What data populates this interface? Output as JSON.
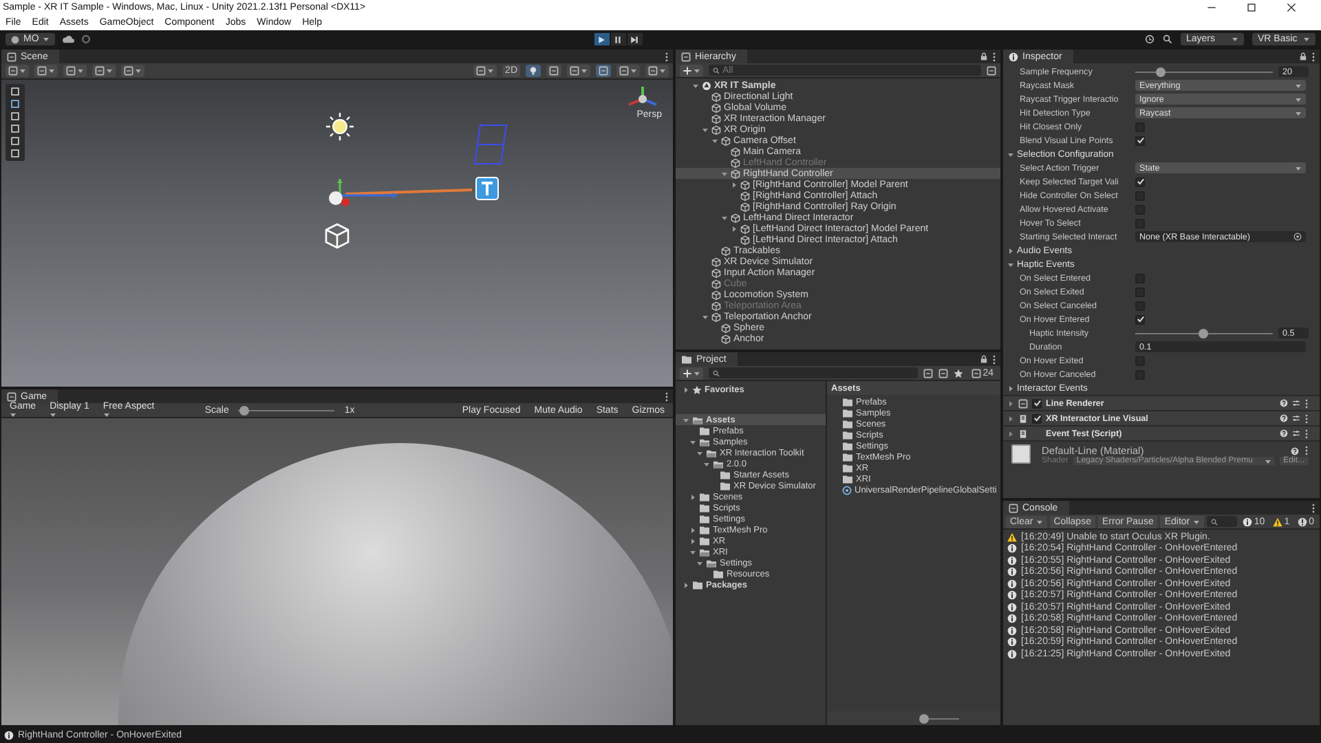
{
  "window": {
    "title": "Sample - XR IT Sample - Windows, Mac, Linux - Unity 2021.2.13f1 Personal <DX11>"
  },
  "menu": [
    "File",
    "Edit",
    "Assets",
    "GameObject",
    "Component",
    "Jobs",
    "Window",
    "Help"
  ],
  "toolbar": {
    "account": "MO",
    "layers": "Layers",
    "layout": "VR Basic"
  },
  "scene": {
    "tab": "Scene",
    "mode_2d": "2D",
    "projection": "Persp"
  },
  "game": {
    "tab": "Game",
    "view": "Game",
    "display": "Display 1",
    "aspect": "Free Aspect",
    "scale_label": "Scale",
    "scale": "1x",
    "level": 0.05,
    "buttons": [
      "Play Focused",
      "Mute Audio",
      "Stats",
      "Gizmos"
    ]
  },
  "hierarchy": {
    "tab": "Hierarchy",
    "search": "All",
    "items": [
      {
        "label": "XR IT Sample",
        "kind": "scene",
        "selected": false,
        "disabled": false,
        "expanded": true,
        "children": [
          {
            "label": "Directional Light",
            "kind": "object",
            "selected": false,
            "disabled": false
          },
          {
            "label": "Global Volume",
            "kind": "object",
            "selected": false,
            "disabled": false
          },
          {
            "label": "XR Interaction Manager",
            "kind": "object",
            "selected": false,
            "disabled": false
          },
          {
            "label": "XR Origin",
            "kind": "object",
            "selected": false,
            "disabled": false,
            "expanded": true,
            "children": [
              {
                "label": "Camera Offset",
                "kind": "object",
                "selected": false,
                "disabled": false,
                "expanded": true,
                "children": [
                  {
                    "label": "Main Camera",
                    "kind": "object",
                    "selected": false,
                    "disabled": false
                  },
                  {
                    "label": "LeftHand Controller",
                    "kind": "object",
                    "selected": false,
                    "disabled": true
                  },
                  {
                    "label": "RightHand Controller",
                    "kind": "object",
                    "selected": true,
                    "disabled": false,
                    "expanded": true,
                    "children": [
                      {
                        "label": "[RightHand Controller] Model Parent",
                        "kind": "object",
                        "selected": false,
                        "disabled": false,
                        "expanded": false
                      },
                      {
                        "label": "[RightHand Controller] Attach",
                        "kind": "object",
                        "selected": false,
                        "disabled": false
                      },
                      {
                        "label": "[RightHand Controller] Ray Origin",
                        "kind": "object",
                        "selected": false,
                        "disabled": false
                      }
                    ]
                  },
                  {
                    "label": "LeftHand Direct Interactor",
                    "kind": "object",
                    "selected": false,
                    "disabled": false,
                    "expanded": true,
                    "children": [
                      {
                        "label": "[LeftHand Direct Interactor] Model Parent",
                        "kind": "object",
                        "selected": false,
                        "disabled": false,
                        "expanded": false
                      },
                      {
                        "label": "[LeftHand Direct Interactor] Attach",
                        "kind": "object",
                        "selected": false,
                        "disabled": false
                      }
                    ]
                  }
                ]
              },
              {
                "label": "Trackables",
                "kind": "object",
                "selected": false,
                "disabled": false
              }
            ]
          },
          {
            "label": "XR Device Simulator",
            "kind": "object",
            "selected": false,
            "disabled": false
          },
          {
            "label": "Input Action Manager",
            "kind": "object",
            "selected": false,
            "disabled": false
          },
          {
            "label": "Cube",
            "kind": "object",
            "selected": false,
            "disabled": true
          },
          {
            "label": "Locomotion System",
            "kind": "object",
            "selected": false,
            "disabled": false
          },
          {
            "label": "Teleportation Area",
            "kind": "object",
            "selected": false,
            "disabled": true
          },
          {
            "label": "Teleportation Anchor",
            "kind": "object",
            "selected": false,
            "disabled": false,
            "expanded": true,
            "children": [
              {
                "label": "Sphere",
                "kind": "object",
                "selected": false,
                "disabled": false
              },
              {
                "label": "Anchor",
                "kind": "object",
                "selected": false,
                "disabled": false
              }
            ]
          }
        ]
      }
    ]
  },
  "project": {
    "tab": "Project",
    "count": "24",
    "tree": [
      {
        "label": "Favorites",
        "kind": "favorites",
        "selected": false,
        "expanded": false
      },
      {
        "label": "Assets",
        "kind": "folder",
        "selected": true,
        "expanded": true,
        "children": [
          {
            "label": "Prefabs",
            "kind": "folder",
            "selected": false
          },
          {
            "label": "Samples",
            "kind": "folder",
            "selected": false,
            "expanded": true,
            "children": [
              {
                "label": "XR Interaction Toolkit",
                "kind": "folder",
                "selected": false,
                "expanded": true,
                "children": [
                  {
                    "label": "2.0.0",
                    "kind": "folder",
                    "selected": false,
                    "expanded": true,
                    "children": [
                      {
                        "label": "Starter Assets",
                        "kind": "folder",
                        "selected": false
                      },
                      {
                        "label": "XR Device Simulator",
                        "kind": "folder",
                        "selected": false
                      }
                    ]
                  }
                ]
              }
            ]
          },
          {
            "label": "Scenes",
            "kind": "folder",
            "selected": false,
            "expanded": false
          },
          {
            "label": "Scripts",
            "kind": "folder",
            "selected": false
          },
          {
            "label": "Settings",
            "kind": "folder",
            "selected": false
          },
          {
            "label": "TextMesh Pro",
            "kind": "folder",
            "selected": false,
            "expanded": false
          },
          {
            "label": "XR",
            "kind": "folder",
            "selected": false,
            "expanded": false
          },
          {
            "label": "XRI",
            "kind": "folder",
            "selected": false,
            "expanded": true,
            "children": [
              {
                "label": "Settings",
                "kind": "folder",
                "selected": false,
                "expanded": true,
                "children": [
                  {
                    "label": "Resources",
                    "kind": "folder",
                    "selected": false
                  }
                ]
              }
            ]
          }
        ]
      },
      {
        "label": "Packages",
        "kind": "folder",
        "selected": false,
        "expanded": false
      }
    ],
    "list_title": "Assets",
    "list": [
      {
        "label": "Prefabs",
        "kind": "folder"
      },
      {
        "label": "Samples",
        "kind": "folder"
      },
      {
        "label": "Scenes",
        "kind": "folder"
      },
      {
        "label": "Scripts",
        "kind": "folder"
      },
      {
        "label": "Settings",
        "kind": "folder"
      },
      {
        "label": "TextMesh Pro",
        "kind": "folder"
      },
      {
        "label": "XR",
        "kind": "folder"
      },
      {
        "label": "XRI",
        "kind": "folder"
      },
      {
        "label": "UniversalRenderPipelineGlobalSetti",
        "kind": "asset"
      }
    ]
  },
  "inspector": {
    "tab": "Inspector",
    "properties": [
      {
        "kind": "slider",
        "label": "Sample Frequency",
        "value": "20",
        "level": 0.18
      },
      {
        "kind": "dropdown",
        "label": "Raycast Mask",
        "value": "Everything"
      },
      {
        "kind": "dropdown",
        "label": "Raycast Trigger Interactio",
        "value": "Ignore"
      },
      {
        "kind": "dropdown",
        "label": "Hit Detection Type",
        "value": "Raycast"
      },
      {
        "kind": "checkbox",
        "label": "Hit Closest Only",
        "checked": false
      },
      {
        "kind": "checkbox",
        "label": "Blend Visual Line Points",
        "checked": true
      },
      {
        "kind": "section",
        "label": "Selection Configuration",
        "expanded": true,
        "children": [
          {
            "kind": "dropdown",
            "label": "Select Action Trigger",
            "value": "State"
          },
          {
            "kind": "checkbox",
            "label": "Keep Selected Target Vali",
            "checked": true
          },
          {
            "kind": "checkbox",
            "label": "Hide Controller On Select",
            "checked": false
          },
          {
            "kind": "checkbox",
            "label": "Allow Hovered Activate",
            "checked": false
          },
          {
            "kind": "checkbox",
            "label": "Hover To Select",
            "checked": false
          },
          {
            "kind": "object",
            "label": "Starting Selected Interact",
            "value": "None (XR Base Interactable)"
          }
        ]
      },
      {
        "kind": "section",
        "label": "Audio Events",
        "expanded": false
      },
      {
        "kind": "section",
        "label": "Haptic Events",
        "expanded": true,
        "children": [
          {
            "kind": "checkbox",
            "label": "On Select Entered",
            "checked": false
          },
          {
            "kind": "checkbox",
            "label": "On Select Exited",
            "checked": false
          },
          {
            "kind": "checkbox",
            "label": "On Select Canceled",
            "checked": false
          },
          {
            "kind": "checkbox",
            "label": "On Hover Entered",
            "checked": true,
            "children": [
              {
                "kind": "slider",
                "label": "Haptic Intensity",
                "value": "0.5",
                "level": 0.49
              },
              {
                "kind": "number",
                "label": "Duration",
                "value": "0.1"
              }
            ]
          },
          {
            "kind": "checkbox",
            "label": "On Hover Exited",
            "checked": false
          },
          {
            "kind": "checkbox",
            "label": "On Hover Canceled",
            "checked": false
          }
        ]
      },
      {
        "kind": "section",
        "label": "Interactor Events",
        "expanded": false
      }
    ],
    "components": [
      {
        "kind": "renderer",
        "name": "Line Renderer",
        "enabled": true
      },
      {
        "kind": "script",
        "name": "XR Interactor Line Visual",
        "enabled": true
      },
      {
        "kind": "script",
        "name": "Event Test (Script)"
      }
    ],
    "material": {
      "name": "Default-Line (Material)",
      "shader_label": "Shader",
      "shader": "Legacy Shaders/Particles/Alpha Blended Premu",
      "edit": "Edit..."
    }
  },
  "console": {
    "tab": "Console",
    "buttons": [
      "Clear",
      "Collapse",
      "Error Pause",
      "Editor"
    ],
    "info_count": "10",
    "warning_count": "1",
    "error_count": "0",
    "entries": [
      {
        "kind": "warning",
        "text": "[16:20:49] Unable to start Oculus XR Plugin."
      },
      {
        "kind": "info",
        "text": "[16:20:54] RightHand Controller - OnHoverEntered"
      },
      {
        "kind": "info",
        "text": "[16:20:55] RightHand Controller - OnHoverExited"
      },
      {
        "kind": "info",
        "text": "[16:20:56] RightHand Controller - OnHoverEntered"
      },
      {
        "kind": "info",
        "text": "[16:20:56] RightHand Controller - OnHoverExited"
      },
      {
        "kind": "info",
        "text": "[16:20:57] RightHand Controller - OnHoverEntered"
      },
      {
        "kind": "info",
        "text": "[16:20:57] RightHand Controller - OnHoverExited"
      },
      {
        "kind": "info",
        "text": "[16:20:58] RightHand Controller - OnHoverEntered"
      },
      {
        "kind": "info",
        "text": "[16:20:58] RightHand Controller - OnHoverExited"
      },
      {
        "kind": "info",
        "text": "[16:20:59] RightHand Controller - OnHoverEntered"
      },
      {
        "kind": "info",
        "text": "[16:21:25] RightHand Controller - OnHoverExited"
      }
    ]
  },
  "status_bar": {
    "kind": "info",
    "text": "RightHand Controller - OnHoverExited"
  }
}
